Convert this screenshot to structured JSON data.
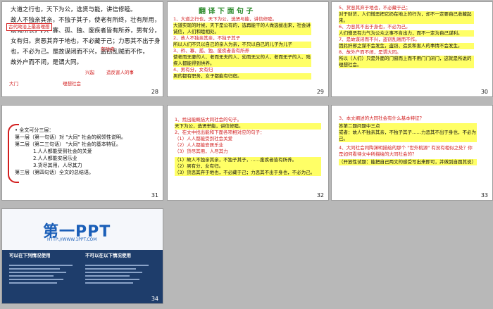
{
  "slides": [
    {
      "num": "28",
      "lines": [
        "大道之行也，天下为公，选贤与能，讲信修睦。",
        "故人不独亲其亲，不独子其子，使老有所终，壮有所用，",
        "幼有所长，矜、寡、孤、独、废疾者皆有所养，男有分，",
        "女有归。货恶其弃于地也，不必藏于己；力恶其不出于身",
        "也，不必为己。是故谋闭而不兴，盗窃乱贼而不作，",
        "故外户而不闭，是谓大同。"
      ],
      "notes": [
        "古代政治上最高理想",
        "大门",
        "理想社会",
        "兴起",
        "造反害人的事",
        "有残疾"
      ]
    },
    {
      "num": "29",
      "title": "翻 译 下 面 句 子",
      "items": [
        "1、大道之行也，天下为公，选贤与能，讲信修睦。",
        "大道实现的时候，天下是公有的，选再能干的人做选拔出来，社会讲诚信，人们和睦相处。",
        "2、故人不独亲其亲，不独子其子",
        "所以人们不只以自己的亲人为亲，不只以自己的儿子为儿子",
        "3、矜、寡、孤、独、废疾者皆有所养",
        "使老而无妻的人、老而无夫的人、幼而无父的人、老而无子的人、残疾人都能得到供养。",
        "4、男有分，女有归",
        "男的都有职务，女子都能有归宿。"
      ]
    },
    {
      "num": "30",
      "items": [
        "5、货恶其弃于地也，不必藏于己；",
        "对于财货，人们憎恶把它扔在地上的行为，却不一定要自己收藏起来。",
        "6、力恶其不出于身也，不必为己。",
        "人们憎恶有力气为公众之事不肯出力，而不一定为自己谋利。",
        "7、是故谋闭而不兴，盗窃乱贼而不作。",
        "因此奸邪之谋不会发生，盗窃、造反和害人的事情不会发生。",
        "8、故外户而不闭，是谓大同。",
        "所以（人们）只是外面的门窗而上而不用门门闭门，这就是所说的理想社会。"
      ]
    },
    {
      "num": "31",
      "items": [
        "• 全文可分三层：",
        "第一层（第一句话）对 \"大同\" 社会的纲领性说明。",
        "第二层（第二三句话） \"大同\" 社会的基本特征。",
        "1.人人都能受到社会的关爱",
        "2.人人都能安居乐业",
        "3.货尽其用，人尽其力",
        "第三层（第四句话）全文的总结语。"
      ]
    },
    {
      "num": "32",
      "items": [
        "1、找出能概括大同社会的句子。",
        "天下为公，选贤举能，讲信修睦。",
        "2、在文中找出能和下面各项相对应的句子：",
        "（1）人人都能受到社会关爱",
        "（2）人人都能安居乐业",
        "（3）货尽其用，人尽其力",
        "（1）故人不独亲其亲，不独子其子，……废疾者皆有所养。",
        "（2）男有分，女有归。",
        "（3）货恶其弃于地也，不必藏于己；力恶其不出于身也，不必为己。"
      ]
    },
    {
      "num": "33",
      "items": [
        "3、本文阐述的大同社会有什么基本特征？",
        "答第二题问题中三点",
        "或者：故人不独亲其亲，不独子其子……力恶其不出于身也，不必为己。",
        "4、大同社会同陶渊明描绘的那个 \"世外桃源\" 有没有相似之处？你是如何看待文中所描绘的大同社会的？",
        "（开放性试题：能把自己两文的感受写出来即可，并做到自圆其说）"
      ]
    },
    {
      "num": "34",
      "logo": "第一PPT",
      "url": "HTTP://WWW.1PPT.COM",
      "col_left_title": "可以在下列情况使用",
      "col_right_title": "不可以在以下情况使用"
    }
  ]
}
